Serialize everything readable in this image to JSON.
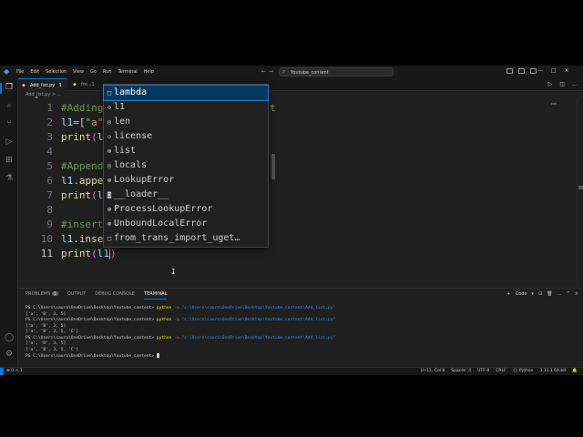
{
  "window": {
    "menu": [
      "File",
      "Edit",
      "Selection",
      "View",
      "Go",
      "Run",
      "Terminal",
      "Help"
    ],
    "search_text": "Youtube_content"
  },
  "tabs": [
    {
      "label": "Add_list.py",
      "marker": "1",
      "active": true
    },
    {
      "label": "fre...1",
      "active": false
    }
  ],
  "breadcrumb": "Add_list.py > ...",
  "editor": {
    "lines": [
      {
        "n": "1",
        "text": "#Adding"
      },
      {
        "n": "2",
        "text_a": "l1",
        "text_b": "=[",
        "text_c": "\"a\""
      },
      {
        "n": "3",
        "text_a": "print",
        "text_b": "(",
        "text_c": "l1"
      },
      {
        "n": "4"
      },
      {
        "n": "5",
        "text": "#Append"
      },
      {
        "n": "6",
        "text_a": "l1",
        "text_b": ".appe"
      },
      {
        "n": "7",
        "text_a": "print",
        "text_b": "(",
        "text_c": "l1"
      },
      {
        "n": "8"
      },
      {
        "n": "9",
        "text": "#insert"
      },
      {
        "n": "10",
        "text_a": "l1",
        "text_b": ".inse"
      },
      {
        "n": "11",
        "text_a": "print",
        "text_b": "(",
        "text_c": "l1",
        "text_d": ")"
      }
    ],
    "line1_tail": "t"
  },
  "suggest": {
    "items": [
      {
        "label": "lambda",
        "icon": "keyword-icon",
        "glyph": "□"
      },
      {
        "label": "l1",
        "icon": "variable-icon",
        "glyph": "◇"
      },
      {
        "label": "len",
        "icon": "function-icon",
        "glyph": "◎"
      },
      {
        "label": "license",
        "icon": "variable-icon",
        "glyph": "◇"
      },
      {
        "label": "list",
        "icon": "class-icon",
        "glyph": "⊛"
      },
      {
        "label": "locals",
        "icon": "function-icon",
        "glyph": "◎"
      },
      {
        "label": "LookupError",
        "icon": "class-icon",
        "glyph": "⊛"
      },
      {
        "label": "__loader__",
        "icon": "variable-icon",
        "glyph": "◙"
      },
      {
        "label": "ProcessLookupError",
        "icon": "class-icon",
        "glyph": "⊛"
      },
      {
        "label": "UnboundLocalError",
        "icon": "class-icon",
        "glyph": "⊛"
      },
      {
        "label": "from_trans_import_uget…",
        "icon": "snippet-icon",
        "glyph": "□"
      }
    ]
  },
  "panel": {
    "tabs": [
      {
        "label": "PROBLEMS",
        "badge": "1"
      },
      {
        "label": "OUTPUT"
      },
      {
        "label": "DEBUG CONSOLE"
      },
      {
        "label": "TERMINAL",
        "active": true
      }
    ],
    "actions": [
      "+",
      "Code",
      "▾",
      "⊡",
      "🗑",
      "…",
      "^",
      "×"
    ],
    "terminal": [
      {
        "prompt": "PS C:\\Users\\saura\\OneDrive\\Desktop\\Youtube_content> ",
        "cmd": "python",
        "flag": " -u ",
        "arg": "\"c:\\Users\\saura\\OneDrive\\Desktop\\Youtube_content\\Add_list.py\""
      },
      {
        "out": "['a', 'B', 3, 5]"
      },
      {
        "prompt": "PS C:\\Users\\saura\\OneDrive\\Desktop\\Youtube_content> ",
        "cmd": "python",
        "flag": " -u ",
        "arg": "\"c:\\Users\\saura\\OneDrive\\Desktop\\Youtube_content\\Add_list.py\""
      },
      {
        "out": "['a', 'B', 3, 5]"
      },
      {
        "out": "['a', 'B', 3, 5, 'C']"
      },
      {
        "prompt": "PS C:\\Users\\saura\\OneDrive\\Desktop\\Youtube_content> ",
        "cmd": "python",
        "flag": " -u ",
        "arg": "\"c:\\Users\\saura\\OneDrive\\Desktop\\Youtube_content\\Add_list.py\""
      },
      {
        "out": "['a', 'B', 3, 5]"
      },
      {
        "out": "['a', 'B', 3, 5, 'C']"
      },
      {
        "prompt": "PS C:\\Users\\saura\\OneDrive\\Desktop\\Youtube_content> "
      }
    ]
  },
  "statusbar": {
    "left": "⊗ 0 ⚠ 1",
    "right": [
      "Ln 11, Col 8",
      "Spaces: 4",
      "UTF-8",
      "CRLF",
      "{} Python",
      "3.11.1 64-bit",
      "🔔"
    ]
  },
  "colors": {
    "accent": "#0078d4",
    "selection": "#04395e",
    "comment": "#6a9955",
    "variable": "#9cdcfe",
    "function": "#dcdcaa",
    "string": "#ce9178"
  }
}
